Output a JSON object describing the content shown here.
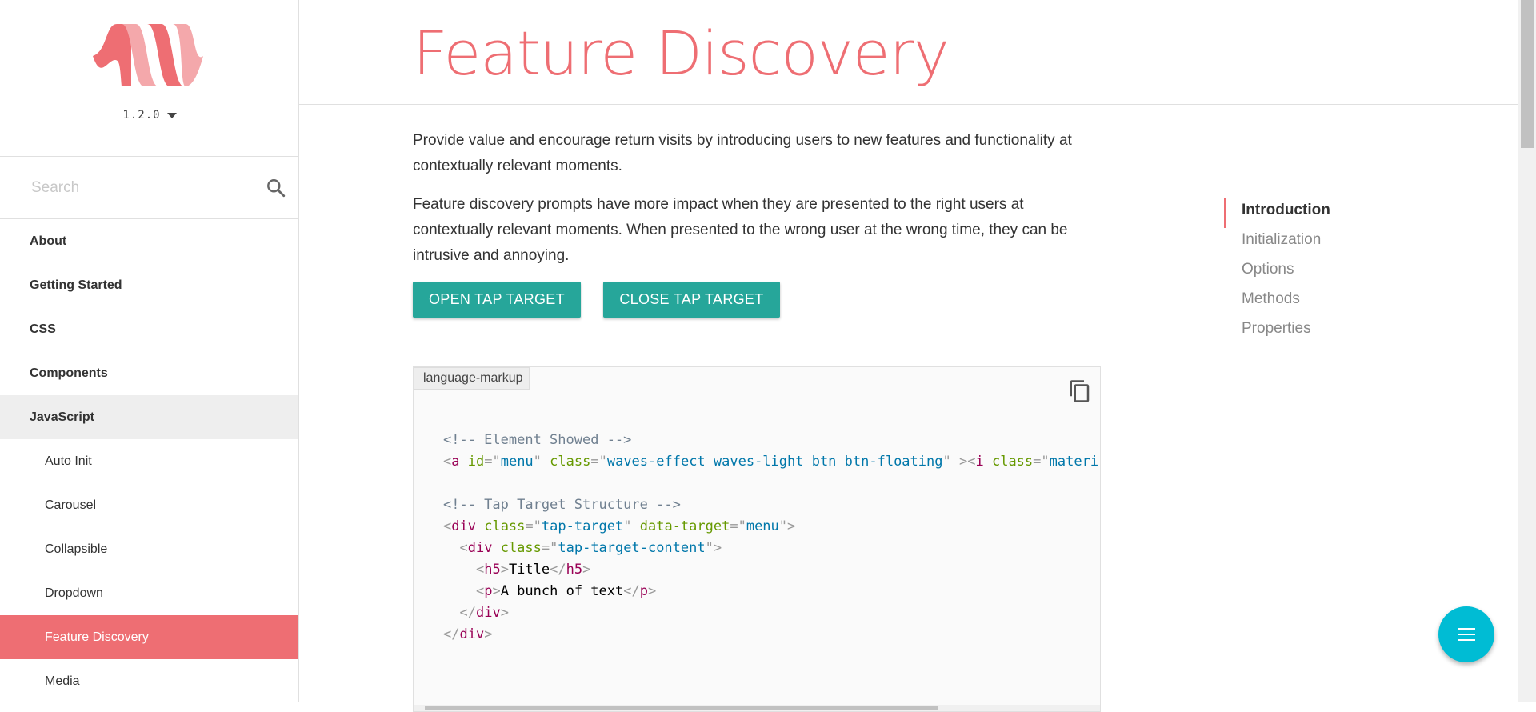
{
  "sidebar": {
    "version": "1.2.0",
    "search_placeholder": "Search",
    "nav": [
      {
        "label": "About"
      },
      {
        "label": "Getting Started"
      },
      {
        "label": "CSS"
      },
      {
        "label": "Components"
      },
      {
        "label": "JavaScript"
      }
    ],
    "subnav": [
      {
        "label": "Auto Init"
      },
      {
        "label": "Carousel"
      },
      {
        "label": "Collapsible"
      },
      {
        "label": "Dropdown"
      },
      {
        "label": "Feature Discovery"
      },
      {
        "label": "Media"
      }
    ]
  },
  "header": {
    "title": "Feature Discovery"
  },
  "main": {
    "intro": "Provide value and encourage return visits by introducing users to new features and functionality at contextually relevant moments.",
    "detail": "Feature discovery prompts have more impact when they are presented to the right users at contextually relevant moments. When presented to the wrong user at the wrong time, they can be intrusive and annoying.",
    "buttons": {
      "open": "Open tap target",
      "close": "Close tap target"
    },
    "code": {
      "language": "language-markup",
      "comment_1": "<!-- Element Showed -->",
      "comment_2": "<!-- Tap Target Structure -->",
      "title_text": "Title",
      "body_text": "A bunch of text"
    }
  },
  "toc": [
    {
      "label": "Introduction"
    },
    {
      "label": "Initialization"
    },
    {
      "label": "Options"
    },
    {
      "label": "Methods"
    },
    {
      "label": "Properties"
    }
  ],
  "colors": {
    "accent": "#ee6e73",
    "button": "#26a69a",
    "fab": "#00bcd4"
  },
  "icons": {
    "search": "search-icon",
    "copy": "copy-icon",
    "fab": "menu-icon",
    "version": "chevron-down-icon"
  }
}
